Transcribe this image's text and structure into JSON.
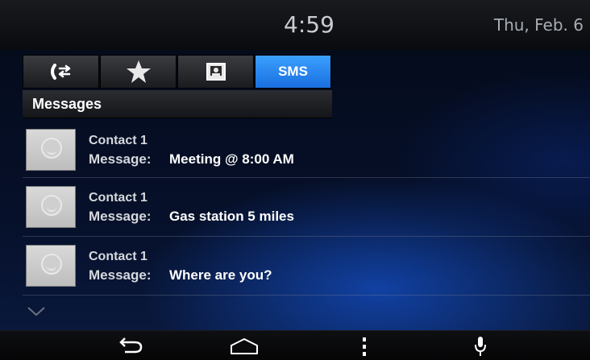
{
  "status": {
    "time": "4:59",
    "date": "Thu, Feb. 6"
  },
  "tabs": [
    {
      "icon": "phone-calls-icon"
    },
    {
      "icon": "star-icon"
    },
    {
      "icon": "contact-card-icon"
    },
    {
      "label": "SMS",
      "active": true
    }
  ],
  "section": {
    "title": "Messages"
  },
  "messages": [
    {
      "contact": "Contact 1",
      "label": "Message:",
      "text": "Meeting @ 8:00 AM"
    },
    {
      "contact": "Contact 1",
      "label": "Message:",
      "text": "Gas station 5 miles"
    },
    {
      "contact": "Contact 1",
      "label": "Message:",
      "text": "Where are you?"
    }
  ],
  "navbar": [
    "back-icon",
    "home-icon",
    "menu-icon",
    "microphone-icon"
  ],
  "colors": {
    "accent": "#2a8cff",
    "text": "#ffffff",
    "muted": "#d6d8dc"
  }
}
